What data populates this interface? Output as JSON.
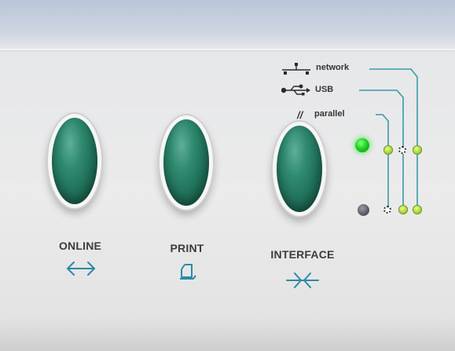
{
  "buttons": [
    {
      "label": "ONLINE",
      "symbol": "left-right-arrow"
    },
    {
      "label": "PRINT",
      "symbol": "page-icon"
    },
    {
      "label": "INTERFACE",
      "symbol": "inward-arrows"
    }
  ],
  "interfaces": {
    "network": "network",
    "usb": "USB",
    "parallel": "parallel",
    "parallel_glyph": "//"
  },
  "colors": {
    "button": "#1d6b55",
    "led_on": "#1fd11f",
    "led_off": "#5a5a66",
    "indicator": "#a8d630",
    "symbol": "#2a8aa8",
    "leader_line": "#3a9aa8"
  }
}
